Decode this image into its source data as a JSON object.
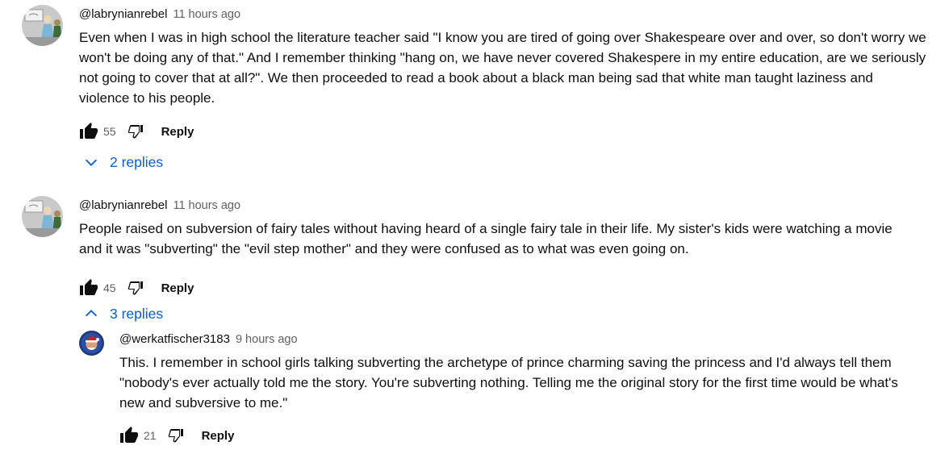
{
  "comments": [
    {
      "handle": "@labrynianrebel",
      "time": "11 hours ago",
      "lines": [
        "Even when I was in high school the literature teacher said \"I know you are tired of going over Shakespeare over and over, so don't worry we",
        "won't be doing any of that.\" And I remember thinking \"hang on, we have never covered Shakespere in my entire education, are we seriously",
        "not going to cover that at all?\". We then proceeded to read a book about a black man being sad that white man taught laziness and",
        "violence to his people."
      ],
      "likes": "55",
      "reply_label": "Reply",
      "replies_label": "2 replies"
    },
    {
      "handle": "@labrynianrebel",
      "time": "11 hours ago",
      "lines": [
        "People raised on subversion of fairy tales without having heard of a single fairy tale in their life. My sister's kids were watching a movie",
        "and it was \"subverting\" the \"evil step mother\" and they were confused as to what was even going on."
      ],
      "likes": "45",
      "reply_label": "Reply",
      "replies_label": "3 replies"
    }
  ],
  "reply": {
    "handle": "@werkatfischer3183",
    "time": "9 hours ago",
    "lines": [
      "This. I remember in school girls talking subverting the archetype of prince charming saving the princess and I'd always tell them",
      "\"nobody's ever actually told me the story. You're subverting nothing. Telling me the original story for the first time would be what's",
      "new and subversive to me.\""
    ],
    "likes": "21",
    "reply_label": "Reply"
  },
  "icons": {
    "like": "thumbs-up-icon",
    "dislike": "thumbs-down-icon",
    "expand": "chevron-down-icon",
    "collapse": "chevron-up-icon"
  },
  "colors": {
    "link_blue": "#065fd4",
    "secondary_text": "#606060",
    "primary_text": "#0f0f0f"
  }
}
